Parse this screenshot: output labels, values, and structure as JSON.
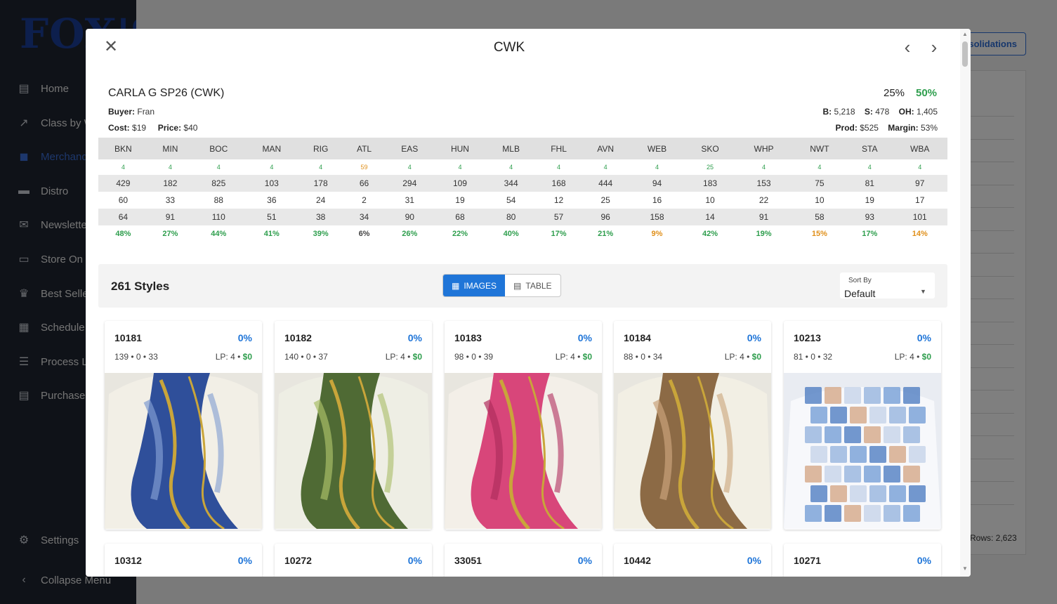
{
  "sidebar": {
    "logo": "FOX'S",
    "items": [
      {
        "label": "Home",
        "icon": "store-icon"
      },
      {
        "label": "Class by W",
        "icon": "trending-icon"
      },
      {
        "label": "Merchand",
        "icon": "bag-icon"
      },
      {
        "label": "Distro",
        "icon": "truck-icon"
      },
      {
        "label": "Newslette",
        "icon": "mail-icon"
      },
      {
        "label": "Store On H",
        "icon": "archive-icon"
      },
      {
        "label": "Best Seller",
        "icon": "trophy-icon"
      },
      {
        "label": "Schedule",
        "icon": "calendar-icon"
      },
      {
        "label": "Process Lis",
        "icon": "list-icon"
      },
      {
        "label": "Purchase O",
        "icon": "document-icon"
      }
    ],
    "settings": "Settings",
    "collapse": "Collapse Menu"
  },
  "background": {
    "button_label": "solidations",
    "rows_label": "Rows: 2,623"
  },
  "modal": {
    "title": "CWK",
    "header": {
      "name": "CARLA G SP26 (CWK)",
      "buyer_label": "Buyer:",
      "buyer": "Fran",
      "cost_label": "Cost:",
      "cost": "$19",
      "price_label": "Price:",
      "price": "$40",
      "pct1": "25%",
      "pct2": "50%",
      "b_label": "B:",
      "b": "5,218",
      "s_label": "S:",
      "s": "478",
      "oh_label": "OH:",
      "oh": "1,405",
      "prod_label": "Prod:",
      "prod": "$525",
      "margin_label": "Margin:",
      "margin": "53%"
    },
    "stores": {
      "headers": [
        "BKN",
        "MIN",
        "BOC",
        "MAN",
        "RIG",
        "ATL",
        "EAS",
        "HUN",
        "MLB",
        "FHL",
        "AVN",
        "WEB",
        "SKO",
        "WHP",
        "NWT",
        "STA",
        "WBA"
      ],
      "mini": [
        "4",
        "4",
        "4",
        "4",
        "4",
        "59",
        "4",
        "4",
        "4",
        "4",
        "4",
        "4",
        "25",
        "4",
        "4",
        "4",
        "4"
      ],
      "mini_colors": [
        "green",
        "green",
        "green",
        "green",
        "green",
        "orange",
        "green",
        "green",
        "green",
        "green",
        "green",
        "green",
        "green",
        "green",
        "green",
        "green",
        "green"
      ],
      "row1": [
        "429",
        "182",
        "825",
        "103",
        "178",
        "66",
        "294",
        "109",
        "344",
        "168",
        "444",
        "94",
        "183",
        "153",
        "75",
        "81",
        "97"
      ],
      "row2": [
        "60",
        "33",
        "88",
        "36",
        "24",
        "2",
        "31",
        "19",
        "54",
        "12",
        "25",
        "16",
        "10",
        "22",
        "10",
        "19",
        "17"
      ],
      "row3": [
        "64",
        "91",
        "110",
        "51",
        "38",
        "34",
        "90",
        "68",
        "80",
        "57",
        "96",
        "158",
        "14",
        "91",
        "58",
        "93",
        "101"
      ],
      "pct": [
        "48%",
        "27%",
        "44%",
        "41%",
        "39%",
        "6%",
        "26%",
        "22%",
        "40%",
        "17%",
        "21%",
        "9%",
        "42%",
        "19%",
        "15%",
        "17%",
        "14%"
      ],
      "pct_colors": [
        "green",
        "green",
        "green",
        "green",
        "green",
        "dark",
        "green",
        "green",
        "green",
        "green",
        "green",
        "orange",
        "green",
        "green",
        "orange",
        "green",
        "orange"
      ]
    },
    "toolbar": {
      "count": "261 Styles",
      "images_label": "IMAGES",
      "table_label": "TABLE",
      "sort_label": "Sort By",
      "sort_value": "Default"
    },
    "cards": [
      {
        "id": "10181",
        "pct": "0%",
        "stats": "139 • 0 • 33",
        "lp": "LP: 4 •",
        "price": "$0",
        "palette": [
          "#f2efe6",
          "#2f4f9a",
          "#c9a53a",
          "#7f9bd0"
        ]
      },
      {
        "id": "10182",
        "pct": "0%",
        "stats": "140 • 0 • 37",
        "lp": "LP: 4 •",
        "price": "$0",
        "palette": [
          "#eeeee4",
          "#4f6a34",
          "#c9a53a",
          "#a8bd66"
        ]
      },
      {
        "id": "10183",
        "pct": "0%",
        "stats": "98 • 0 • 39",
        "lp": "LP: 4 •",
        "price": "$0",
        "palette": [
          "#f3efe8",
          "#d8467a",
          "#c9a53a",
          "#b02d5e"
        ]
      },
      {
        "id": "10184",
        "pct": "0%",
        "stats": "88 • 0 • 34",
        "lp": "LP: 4 •",
        "price": "$0",
        "palette": [
          "#f2efe4",
          "#8c6a45",
          "#c9a53a",
          "#c9a37a"
        ]
      },
      {
        "id": "10213",
        "pct": "0%",
        "stats": "81 • 0 • 32",
        "lp": "LP: 4 •",
        "price": "$0",
        "palette": [
          "#e9ecf2",
          "#5b86c5",
          "#d7ad8e",
          "#9cb8df"
        ]
      },
      {
        "id": "10312",
        "pct": "0%"
      },
      {
        "id": "10272",
        "pct": "0%"
      },
      {
        "id": "33051",
        "pct": "0%"
      },
      {
        "id": "10442",
        "pct": "0%"
      },
      {
        "id": "10271",
        "pct": "0%"
      }
    ]
  }
}
